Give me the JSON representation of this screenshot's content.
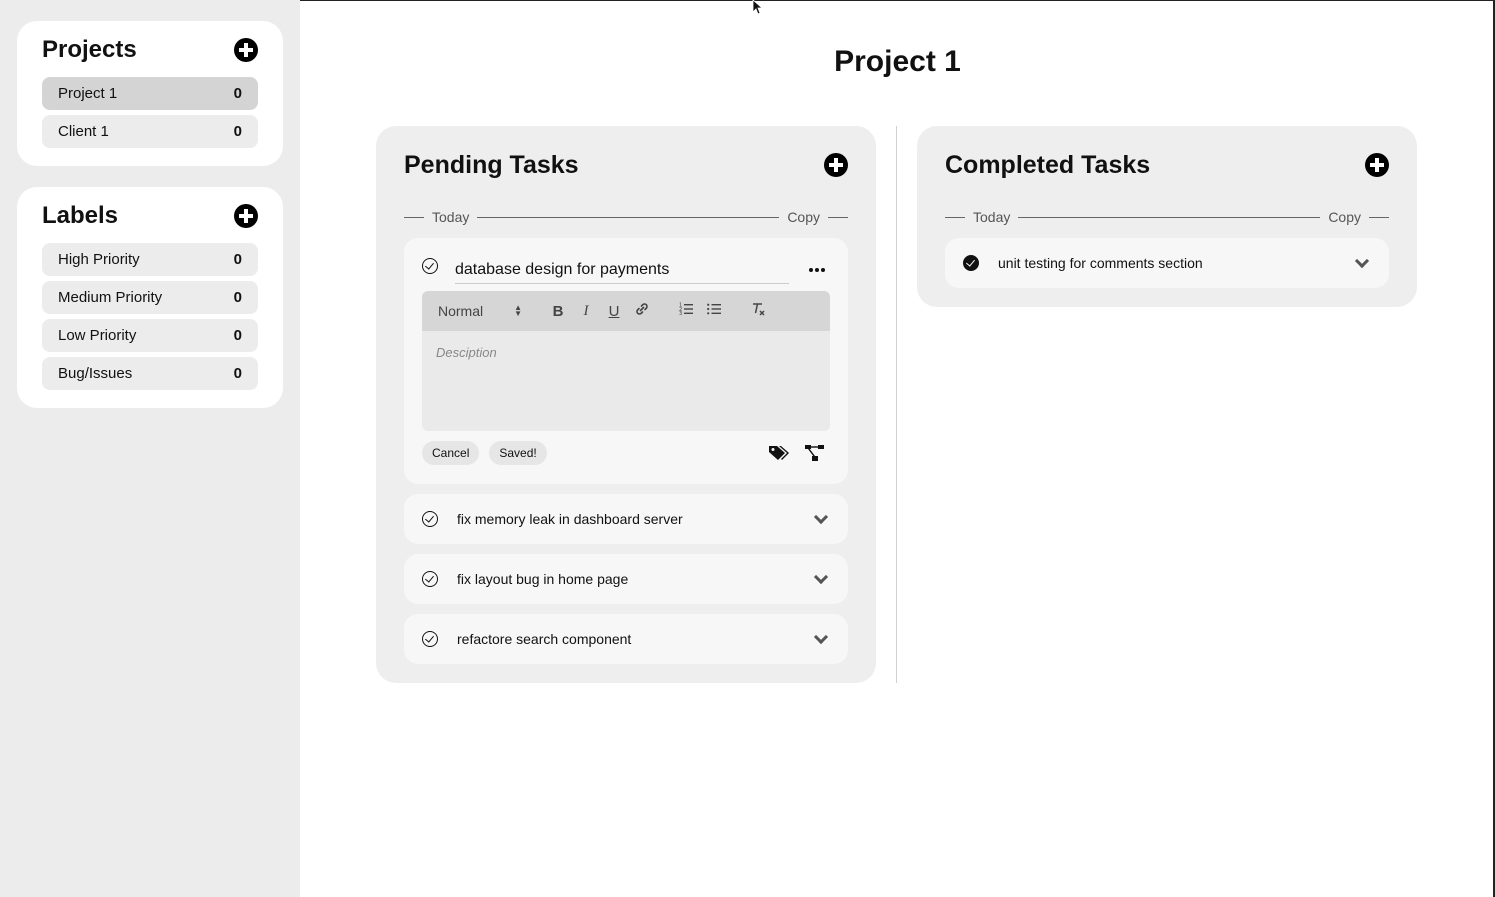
{
  "sidebar": {
    "projects": {
      "title": "Projects",
      "items": [
        {
          "label": "Project 1",
          "count": "0"
        },
        {
          "label": "Client 1",
          "count": "0"
        }
      ]
    },
    "labels": {
      "title": "Labels",
      "items": [
        {
          "label": "High Priority",
          "count": "0"
        },
        {
          "label": "Medium Priority",
          "count": "0"
        },
        {
          "label": "Low Priority",
          "count": "0"
        },
        {
          "label": "Bug/Issues",
          "count": "0"
        }
      ]
    }
  },
  "main": {
    "title": "Project 1",
    "pending": {
      "title": "Pending Tasks",
      "date_label": "Today",
      "copy_label": "Copy",
      "editing_task": {
        "title_value": "database design for payments",
        "format_select": "Normal",
        "description_placeholder": "Desciption",
        "cancel_label": "Cancel",
        "saved_label": "Saved!"
      },
      "tasks": [
        {
          "text": "fix memory leak in dashboard server"
        },
        {
          "text": "fix layout bug in home page"
        },
        {
          "text": "refactore search component"
        }
      ]
    },
    "completed": {
      "title": "Completed Tasks",
      "date_label": "Today",
      "copy_label": "Copy",
      "tasks": [
        {
          "text": "unit testing for comments section"
        }
      ]
    }
  }
}
